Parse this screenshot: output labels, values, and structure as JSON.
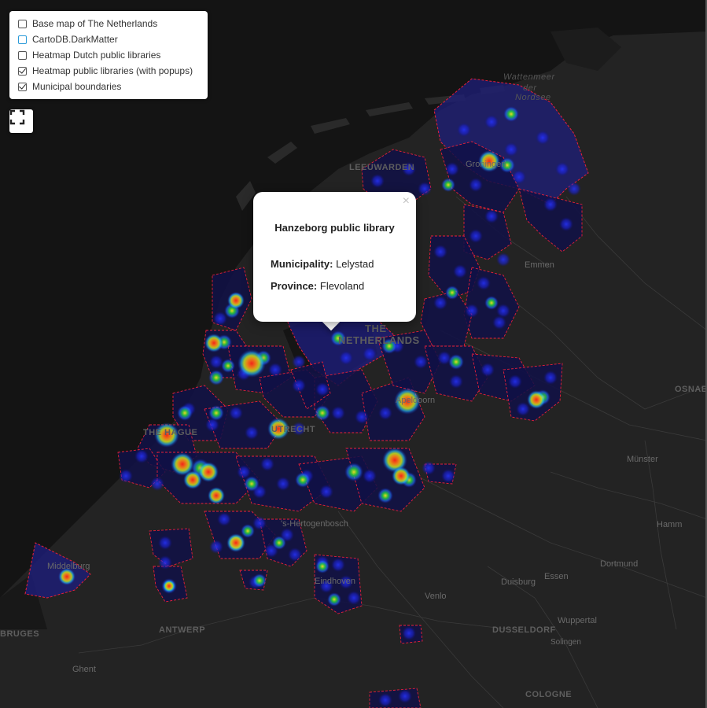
{
  "layer_control": {
    "layers": [
      {
        "label": "Base map of The Netherlands",
        "checked": false
      },
      {
        "label": "CartoDB.DarkMatter",
        "checked": false
      },
      {
        "label": "Heatmap Dutch public libraries",
        "checked": false
      },
      {
        "label": "Heatmap public libraries (with popups)",
        "checked": true
      },
      {
        "label": "Municipal boundaries",
        "checked": true
      }
    ]
  },
  "fullscreen_icon": "expand-icon",
  "popup": {
    "title": "Hanzeborg public library",
    "municipality_label": "Municipality:",
    "municipality": "Lelystad",
    "province_label": "Province:",
    "province": "Flevoland",
    "close": "×"
  },
  "map_labels": {
    "wattenmeer": "Wattenmeer",
    "der": "der",
    "nordsee": "Nordsee",
    "leeuwarden": "LEEUWARDEN",
    "groningen": "Groningen",
    "emmen": "Emmen",
    "the": "THE",
    "netherlands": "NETHERLANDS",
    "apeldoorn": "Apeldoorn",
    "the_hague": "THE HAGUE",
    "utrecht": "UTRECHT",
    "osnabrueck": "OSNAB",
    "muenster": "Münster",
    "hertogenbosch": "'s-Hertogenbosch",
    "hamm": "Hamm",
    "middelburg": "Middelburg",
    "dortmund": "Dortmund",
    "eindhoven": "Eindhoven",
    "duisburg": "Duisburg",
    "essen": "Essen",
    "venlo": "Venlo",
    "bruges": "BRUGES",
    "antwerp": "ANTWERP",
    "dusseldorf": "DUSSELDORF",
    "wuppertal": "Wuppertal",
    "solingen": "Solingen",
    "ghent": "Ghent",
    "cologne": "COLOGNE"
  },
  "colors": {
    "background": "#232323",
    "sea": "#141414",
    "boundary": "#e8203a",
    "municipality_fill": "#1a1a7a",
    "heat_low": "#1a2cff",
    "heat_mid": "#19d43a",
    "heat_high": "#f2261a"
  }
}
